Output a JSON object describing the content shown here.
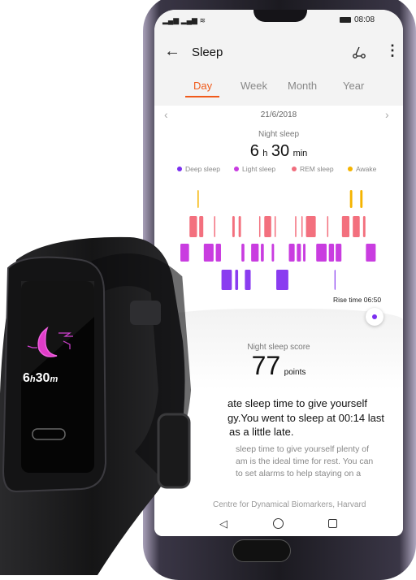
{
  "status": {
    "time": "08:08"
  },
  "header": {
    "title": "Sleep"
  },
  "tabs": [
    {
      "label": "Day",
      "active": true
    },
    {
      "label": "Week"
    },
    {
      "label": "Month"
    },
    {
      "label": "Year"
    }
  ],
  "date": "21/6/2018",
  "summary": {
    "label": "Night sleep",
    "hours": "6",
    "h_unit": "h",
    "minutes": "30",
    "min_unit": "min"
  },
  "legend": [
    {
      "label": "Deep sleep",
      "color": "#7b2ff0"
    },
    {
      "label": "Light sleep",
      "color": "#c83ce0"
    },
    {
      "label": "REM sleep",
      "color": "#f06e7e"
    },
    {
      "label": "Awake",
      "color": "#f5b400"
    }
  ],
  "chart_data": {
    "type": "timeline",
    "stages": [
      "awake",
      "rem",
      "light",
      "deep"
    ],
    "segments": [
      [
        "light",
        16
      ],
      [
        "rem",
        14
      ],
      [
        "awake",
        3
      ],
      [
        "rem",
        8
      ],
      [
        "light",
        18
      ],
      [
        "rem",
        3
      ],
      [
        "light",
        10
      ],
      [
        "deep",
        19
      ],
      [
        "rem",
        5
      ],
      [
        "deep",
        6
      ],
      [
        "rem",
        5
      ],
      [
        "light",
        6
      ],
      [
        "deep",
        11
      ],
      [
        "light",
        14
      ],
      [
        "rem",
        3
      ],
      [
        "light",
        6
      ],
      [
        "rem",
        13
      ],
      [
        "light",
        5
      ],
      [
        "rem",
        3
      ],
      [
        "deep",
        22
      ],
      [
        "light",
        11
      ],
      [
        "rem",
        3
      ],
      [
        "light",
        8
      ],
      [
        "rem",
        3
      ],
      [
        "light",
        5
      ],
      [
        "rem",
        18
      ],
      [
        "light",
        19
      ],
      [
        "rem",
        3
      ],
      [
        "light",
        10
      ],
      [
        "deep",
        2
      ],
      [
        "light",
        11
      ],
      [
        "rem",
        14
      ],
      [
        "awake",
        5
      ],
      [
        "rem",
        13
      ],
      [
        "awake",
        5
      ],
      [
        "rem",
        5
      ],
      [
        "light",
        18
      ]
    ],
    "rise_time_label": "Rise time 06:50"
  },
  "score": {
    "label": "Night sleep score",
    "value": "77",
    "unit": "points"
  },
  "advice": {
    "lines": [
      "ate sleep time to give yourself",
      "gy.You went to sleep at 00:14 last",
      "as a little late."
    ],
    "detail": [
      "sleep time to give yourself plenty of",
      "am is the ideal time for rest. You can",
      "to set alarms to help staying on a"
    ],
    "source": "Centre for Dynamical Biomarkers, Harvard"
  },
  "band": {
    "hours": "6",
    "h": "h",
    "minutes": "30",
    "m": "m"
  }
}
